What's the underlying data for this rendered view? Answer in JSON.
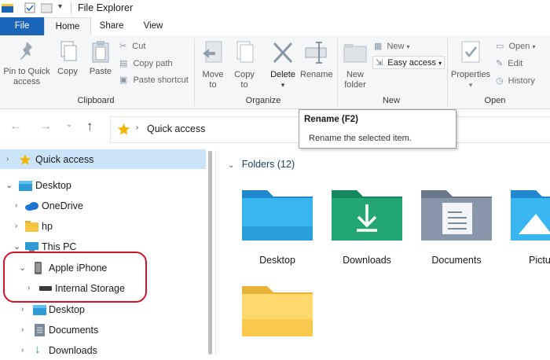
{
  "window": {
    "title": "File Explorer"
  },
  "tabs": {
    "file": "File",
    "home": "Home",
    "share": "Share",
    "view": "View"
  },
  "ribbon": {
    "clipboard": {
      "pin_to_quick_access_line1": "Pin to Quick",
      "pin_to_quick_access_line2": "access",
      "copy": "Copy",
      "paste": "Paste",
      "cut": "Cut",
      "copy_path": "Copy path",
      "paste_shortcut": "Paste shortcut",
      "group_label": "Clipboard"
    },
    "organize": {
      "move_to_line1": "Move",
      "move_to_line2": "to",
      "copy_to_line1": "Copy",
      "copy_to_line2": "to",
      "delete": "Delete",
      "rename": "Rename",
      "group_label": "Organize"
    },
    "new": {
      "new_folder_line1": "New",
      "new_folder_line2": "folder",
      "new_item": "New",
      "easy_access": "Easy access",
      "group_label": "New"
    },
    "open": {
      "properties": "Properties",
      "open": "Open",
      "edit": "Edit",
      "history": "History",
      "group_label": "Open"
    }
  },
  "tooltip": {
    "title": "Rename (F2)",
    "body": "Rename the selected item."
  },
  "address": {
    "path": "Quick access"
  },
  "nav_pane": {
    "items": [
      {
        "label": "Quick access"
      },
      {
        "label": "Desktop"
      },
      {
        "label": "OneDrive"
      },
      {
        "label": "hp"
      },
      {
        "label": "This PC"
      },
      {
        "label": "Apple iPhone"
      },
      {
        "label": "Internal Storage"
      },
      {
        "label": "Desktop"
      },
      {
        "label": "Documents"
      },
      {
        "label": "Downloads"
      }
    ]
  },
  "content": {
    "section_header": "Folders (12)",
    "folders": [
      {
        "label": "Desktop"
      },
      {
        "label": "Downloads"
      },
      {
        "label": "Documents"
      },
      {
        "label": "Pictu"
      },
      {
        "label": ""
      }
    ]
  },
  "colors": {
    "accent": "#1a65b8",
    "selection": "#cce4f7",
    "highlight_ring": "#d3132a",
    "folder_yellow": "#f5c542"
  }
}
